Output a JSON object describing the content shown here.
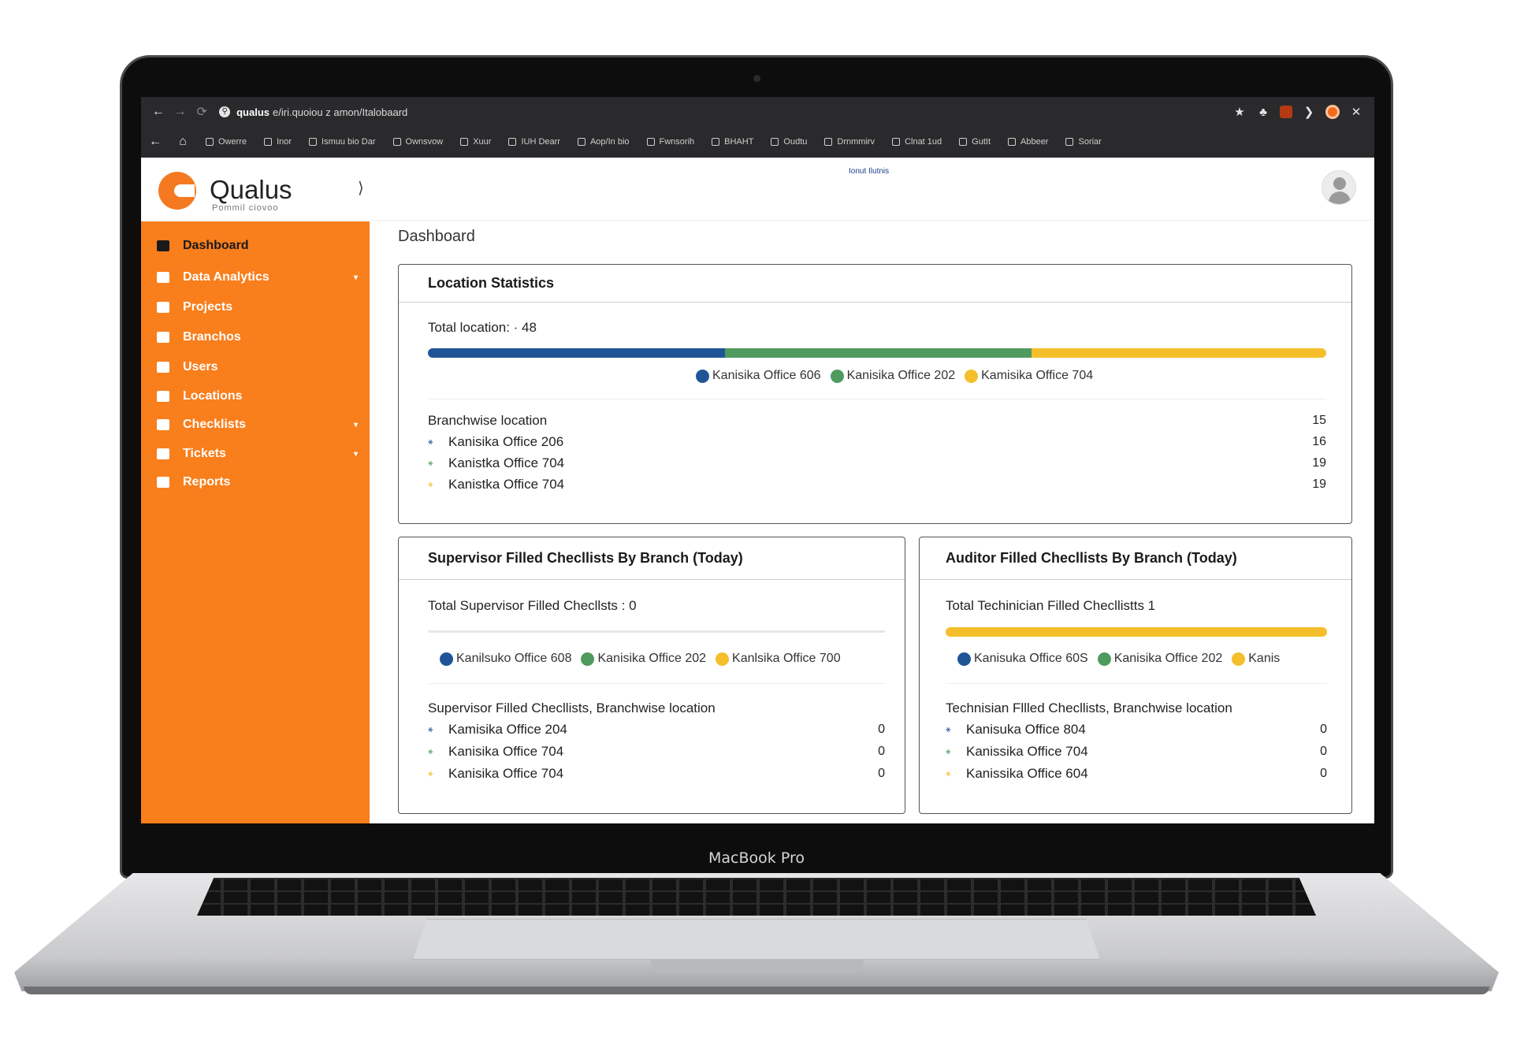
{
  "device": {
    "label": "MacBook Pro"
  },
  "browser": {
    "url_host": "qualus",
    "url_path": "e/iri.quoiou z amon/Italobaard",
    "bookmarks": [
      "Owerre",
      "Inor",
      "Ismuu bio Dar",
      "Ownsvow",
      "Xuur",
      "IUH Dearr",
      "Aop/In bio",
      "Fwnsorih",
      "BHAHT",
      "Oudtu",
      "Drnmmirv",
      "Clnat 1ud",
      "GutIt",
      "Abbeer",
      "Soriar"
    ]
  },
  "app": {
    "logo_name": "Qualus",
    "logo_tagline": "Pommil ciovoo",
    "header_center": "Ionut Ilutnis"
  },
  "sidebar": {
    "items": [
      {
        "label": "Dashboard",
        "active": true,
        "chevron": false
      },
      {
        "label": "Data Analytics",
        "active": false,
        "chevron": true
      },
      {
        "label": "Projects",
        "active": false,
        "chevron": false
      },
      {
        "label": "Branchos",
        "active": false,
        "chevron": false
      },
      {
        "label": "Users",
        "active": false,
        "chevron": false
      },
      {
        "label": "Locations",
        "active": false,
        "chevron": false
      },
      {
        "label": "Checklists",
        "active": false,
        "chevron": true
      },
      {
        "label": "Tickets",
        "active": false,
        "chevron": true
      },
      {
        "label": "Reports",
        "active": false,
        "chevron": false
      }
    ]
  },
  "page": {
    "title": "Dashboard"
  },
  "colors": {
    "blue": "#1f5597",
    "green": "#4f9a5e",
    "yellow": "#f4bf2b",
    "orange": "#f97e1c"
  },
  "location_stats": {
    "title": "Location Statistics",
    "total_label": "Total location:  · 48",
    "bar_segments": [
      0.331,
      0.341,
      0.328
    ],
    "legend": [
      "Kanisika Office 606",
      "Kanisika Office 202",
      "Kamisika Office 704"
    ],
    "list_title": "Branchwise location",
    "list_total": "15",
    "rows": [
      {
        "name": "Kanisika Office 206",
        "value": "16"
      },
      {
        "name": "Kanistka Office 704",
        "value": "19"
      },
      {
        "name": "Kanistka Office 704",
        "value": "19"
      }
    ]
  },
  "supervisor": {
    "title": "Supervisor Filled Checllists By Branch (Today)",
    "total_label": "Total Supervisor Filled Checllsts : 0",
    "bar_segments": [
      0,
      0,
      0
    ],
    "legend": [
      "Kanilsuko Office 608",
      "Kanisika Office 202",
      "Kanlsika Office 700"
    ],
    "list_title": "Supervisor Filled Checllists, Branchwise location",
    "rows": [
      {
        "name": "Kamisika Office 204",
        "value": "0"
      },
      {
        "name": "Kanisika Office 704",
        "value": "0"
      },
      {
        "name": "Kanisika Office 704",
        "value": "0"
      }
    ]
  },
  "auditor": {
    "title": "Auditor Filled Checllists By Branch (Today)",
    "total_label": "Total Techinician Filled Checllistts  1",
    "bar_segments": [
      0,
      0,
      1
    ],
    "legend": [
      "Kanisuka Office 60S",
      "Kanisika Office 202",
      "Kanis"
    ],
    "list_title": "Technisian Fllled Checllists, Branchwise location",
    "rows": [
      {
        "name": "Kanisuka Office 804",
        "value": "0"
      },
      {
        "name": "Kanissika Office 704",
        "value": "0"
      },
      {
        "name": "Kanissika Office 604",
        "value": "0"
      }
    ]
  }
}
